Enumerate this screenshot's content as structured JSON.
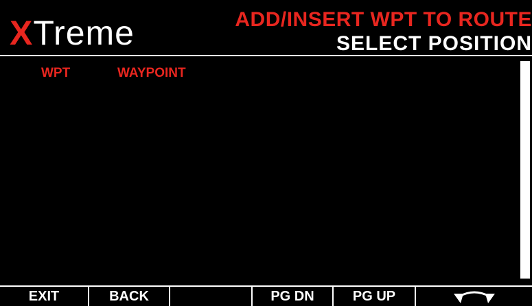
{
  "header": {
    "logo_x": "X",
    "logo_rest": "Treme",
    "title": "ADD/INSERT WPT TO ROUTE",
    "subtitle": "SELECT POSITION"
  },
  "list": {
    "columns": [
      "WPT",
      "WAYPOINT"
    ],
    "rows": []
  },
  "footer": {
    "keys": [
      "EXIT",
      "BACK",
      "",
      "PG DN",
      "PG UP"
    ],
    "rotate_icon": "rotate-knob-icon"
  },
  "colors": {
    "accent": "#e8261f",
    "background": "#000000",
    "text": "#ffffff"
  }
}
